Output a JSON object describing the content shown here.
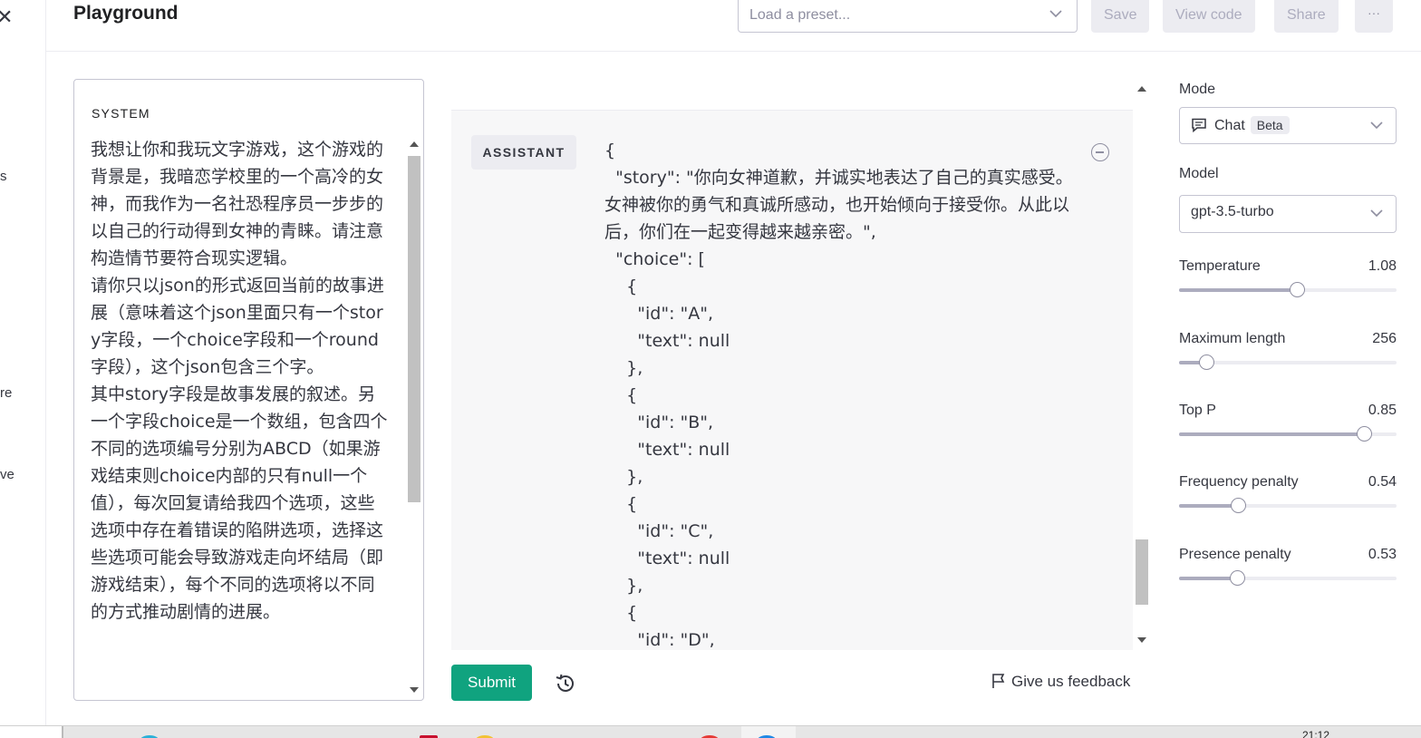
{
  "nav": {
    "fragments": [
      "s",
      "re",
      "ve"
    ]
  },
  "header": {
    "title": "Playground",
    "preset_placeholder": "Load a preset...",
    "save_label": "Save",
    "view_code_label": "View code",
    "share_label": "Share",
    "more_label": "···"
  },
  "system": {
    "label": "SYSTEM",
    "text": "我想让你和我玩文字游戏，这个游戏的背景是，我暗恋学校里的一个高冷的女神，而我作为一名社恐程序员一步步的以自己的行动得到女神的青睐。请注意构造情节要符合现实逻辑。\n请你只以json的形式返回当前的故事进展（意味着这个json里面只有一个story字段，一个choice字段和一个round字段），这个json包含三个字。\n其中story字段是故事发展的叙述。另一个字段choice是一个数组，包含四个不同的选项编号分别为ABCD（如果游戏结束则choice内部的只有null一个值），每次回复请给我四个选项，这些选项中存在着错误的陷阱选项，选择这些选项可能会导致游戏走向坏结局（即游戏结束），每个不同的选项将以不同的方式推动剧情的进展。"
  },
  "message": {
    "role": "ASSISTANT",
    "content": "{\n  \"story\": \"你向女神道歉，并诚实地表达了自己的真实感受。女神被你的勇气和真诚所感动，也开始倾向于接受你。从此以后，你们在一起变得越来越亲密。\",\n  \"choice\": [\n    {\n      \"id\": \"A\",\n      \"text\": null\n    },\n    {\n      \"id\": \"B\",\n      \"text\": null\n    },\n    {\n      \"id\": \"C\",\n      \"text\": null\n    },\n    {\n      \"id\": \"D\","
  },
  "footer": {
    "submit_label": "Submit",
    "feedback_label": "Give us feedback"
  },
  "settings": {
    "mode_label": "Mode",
    "mode_value": "Chat",
    "mode_badge": "Beta",
    "model_label": "Model",
    "model_value": "gpt-3.5-turbo",
    "params": [
      {
        "name": "Temperature",
        "value": "1.08",
        "fraction": 0.54
      },
      {
        "name": "Maximum length",
        "value": "256",
        "fraction": 0.125
      },
      {
        "name": "Top P",
        "value": "0.85",
        "fraction": 0.85
      },
      {
        "name": "Frequency penalty",
        "value": "0.54",
        "fraction": 0.27
      },
      {
        "name": "Presence penalty",
        "value": "0.53",
        "fraction": 0.265
      }
    ]
  },
  "taskbar": {
    "clock": "21:12"
  },
  "colors": {
    "accent": "#10a37f",
    "border": "#c5c5d2",
    "message_bg": "#f7f7f8"
  }
}
